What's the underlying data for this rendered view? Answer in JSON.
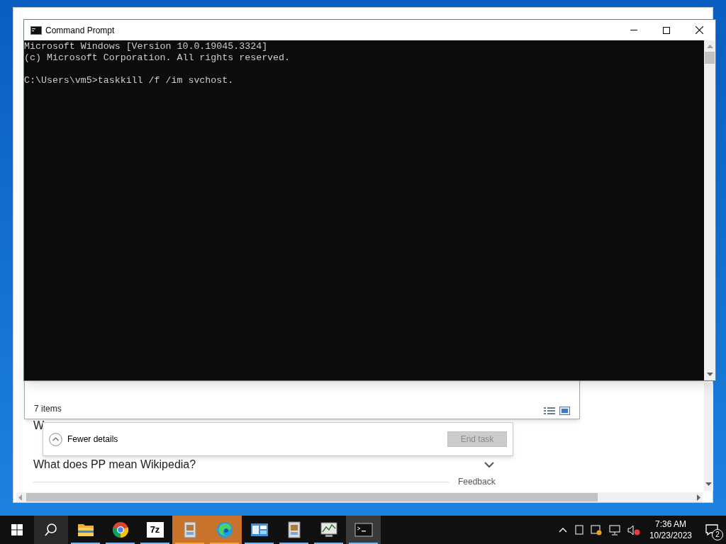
{
  "browser": {
    "items": [
      {
        "text": "W"
      },
      {
        "text": "What does PP mean Wikipedia?"
      }
    ],
    "feedback": "Feedback"
  },
  "explorer": {
    "status": "7 items"
  },
  "task_manager": {
    "details_toggle": "Fewer details",
    "end_task": {
      "label": "End task",
      "disabled": true
    }
  },
  "command_prompt": {
    "title": "Command Prompt",
    "output": [
      "Microsoft Windows [Version 10.0.19045.3324]",
      "(c) Microsoft Corporation. All rights reserved."
    ],
    "prompt": "C:\\Users\\vm5>taskkill /f /im svchost."
  },
  "taskbar": {
    "apps": [
      {
        "kind": "folder",
        "running": true,
        "flashing": false,
        "selected": false
      },
      {
        "kind": "chrome",
        "running": true,
        "flashing": false,
        "selected": false
      },
      {
        "kind": "sevenzip",
        "label": "7z",
        "running": true,
        "flashing": false,
        "selected": false
      },
      {
        "kind": "installer",
        "running": true,
        "flashing": true,
        "selected": false
      },
      {
        "kind": "edge",
        "running": true,
        "flashing": true,
        "selected": false
      },
      {
        "kind": "panel",
        "running": true,
        "flashing": false,
        "selected": false
      },
      {
        "kind": "installer",
        "running": true,
        "flashing": false,
        "selected": false
      },
      {
        "kind": "monitor",
        "running": true,
        "flashing": false,
        "selected": false
      },
      {
        "kind": "console",
        "running": true,
        "flashing": false,
        "selected": true
      }
    ],
    "time": "7:36 AM",
    "date": "10/23/2023",
    "notifications": "2"
  }
}
